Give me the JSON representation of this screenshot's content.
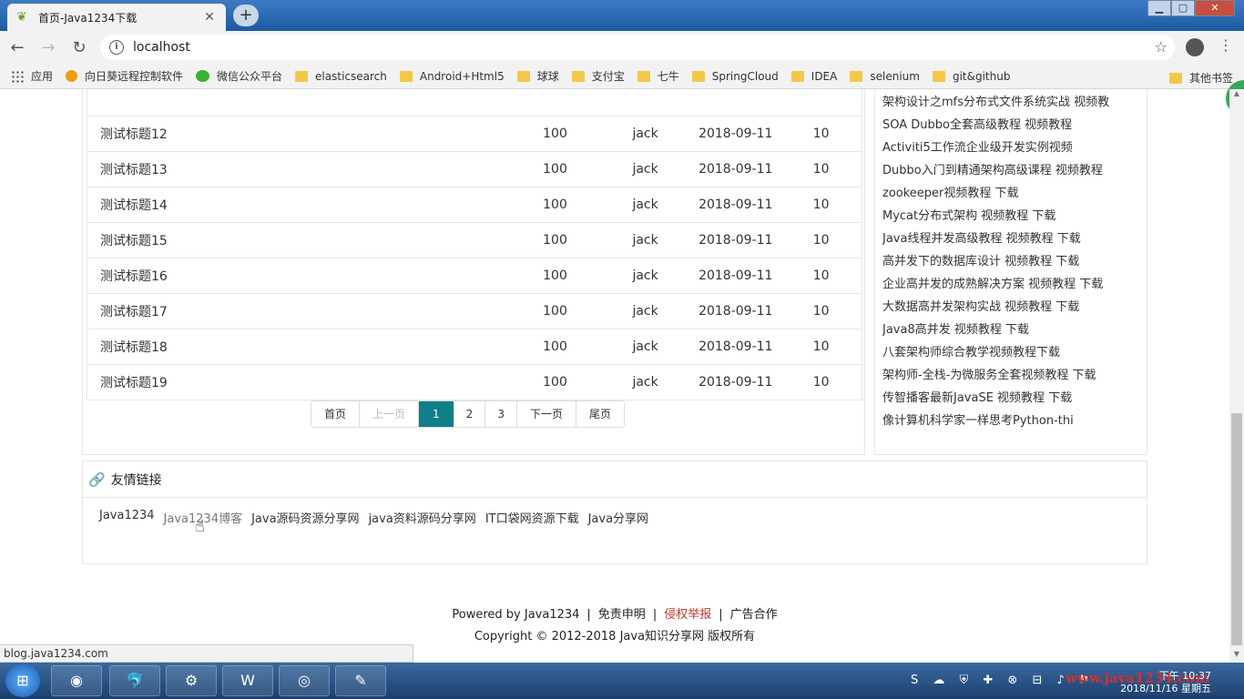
{
  "browser": {
    "tab_title": "首页-Java1234下载",
    "tab_close": "✕",
    "new_tab": "+",
    "url": "localhost",
    "status_url": "blog.java1234.com",
    "bookmarks": [
      {
        "label": "应用",
        "icon": "apps-grid-icon"
      },
      {
        "label": "向日葵远程控制软件",
        "icon": "sunflower-icon"
      },
      {
        "label": "微信公众平台",
        "icon": "wechat-icon"
      },
      {
        "label": "elasticsearch",
        "icon": "folder-icon"
      },
      {
        "label": "Android+Html5",
        "icon": "folder-icon"
      },
      {
        "label": "球球",
        "icon": "folder-icon"
      },
      {
        "label": "支付宝",
        "icon": "folder-icon"
      },
      {
        "label": "七牛",
        "icon": "folder-icon"
      },
      {
        "label": "SpringCloud",
        "icon": "folder-icon"
      },
      {
        "label": "IDEA",
        "icon": "folder-icon"
      },
      {
        "label": "selenium",
        "icon": "folder-icon"
      },
      {
        "label": "git&github",
        "icon": "folder-icon"
      }
    ],
    "other_bookmarks": "其他书签"
  },
  "articles": {
    "rows": [
      {
        "title": "测试标题12",
        "reads": "100",
        "author": "jack",
        "date": "2018-09-11",
        "count": "10"
      },
      {
        "title": "测试标题13",
        "reads": "100",
        "author": "jack",
        "date": "2018-09-11",
        "count": "10"
      },
      {
        "title": "测试标题14",
        "reads": "100",
        "author": "jack",
        "date": "2018-09-11",
        "count": "10"
      },
      {
        "title": "测试标题15",
        "reads": "100",
        "author": "jack",
        "date": "2018-09-11",
        "count": "10"
      },
      {
        "title": "测试标题16",
        "reads": "100",
        "author": "jack",
        "date": "2018-09-11",
        "count": "10"
      },
      {
        "title": "测试标题17",
        "reads": "100",
        "author": "jack",
        "date": "2018-09-11",
        "count": "10"
      },
      {
        "title": "测试标题18",
        "reads": "100",
        "author": "jack",
        "date": "2018-09-11",
        "count": "10"
      },
      {
        "title": "测试标题19",
        "reads": "100",
        "author": "jack",
        "date": "2018-09-11",
        "count": "10"
      }
    ]
  },
  "pager": {
    "first": "首页",
    "prev": "上一页",
    "pages": [
      "1",
      "2",
      "3"
    ],
    "active": "1",
    "next": "下一页",
    "last": "尾页"
  },
  "sidebar": {
    "items": [
      "架构设计之mfs分布式文件系统实战 视频教",
      "SOA Dubbo全套高级教程 视频教程",
      "Activiti5工作流企业级开发实例视频",
      "Dubbo入门到精通架构高级课程 视频教程",
      "zookeeper视频教程 下载",
      "Mycat分布式架构 视频教程 下载",
      "Java线程并发高级教程 视频教程 下载",
      "高并发下的数据库设计 视频教程 下载",
      "企业高并发的成熟解决方案 视频教程 下载",
      "大数据高并发架构实战 视频教程 下载",
      "Java8高并发 视频教程 下载",
      "八套架构师综合教学视频教程下载",
      "架构师-全栈-为微服务全套视频教程 下载",
      "传智播客最新JavaSE 视频教程 下载",
      "像计算机科学家一样思考Python-thi"
    ]
  },
  "links": {
    "heading": "友情链接",
    "items": [
      "Java1234",
      "Java1234博客",
      "Java源码资源分享网",
      "java资料源码分享网",
      "IT口袋网资源下载",
      "Java分享网"
    ]
  },
  "footer": {
    "powered": "Powered by Java1234",
    "disclaimer": "免责申明",
    "report": "侵权举报",
    "ads": "广告合作",
    "copyright": "Copyright © 2012-2018 Java知识分享网 版权所有"
  },
  "taskbar": {
    "watermark": "www.java1234.com",
    "time": "下午 10:37",
    "date": "2018/11/16 星期五"
  },
  "colors": {
    "active_page": "#0f7f8a",
    "report_link": "#c0392b"
  }
}
